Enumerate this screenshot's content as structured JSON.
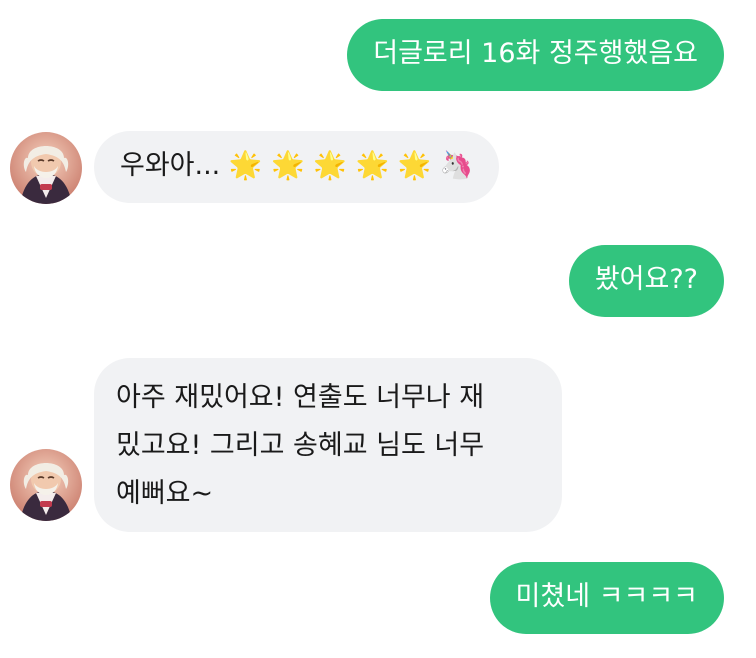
{
  "messages": [
    {
      "id": "m1",
      "from": "me",
      "text": "더글로리 16화 정주행했음요"
    },
    {
      "id": "m2",
      "from": "other",
      "text": "우와아... 🌟 🌟 🌟 🌟 🌟  🦄"
    },
    {
      "id": "m3",
      "from": "me",
      "text": "봤어요??"
    },
    {
      "id": "m4",
      "from": "other",
      "lines": [
        "아주 재밌어요! 연출도 너무나 재",
        "밌고요! 그리고 송혜교 님도 너무",
        "예뻐요~"
      ]
    },
    {
      "id": "m5",
      "from": "me",
      "text": "미쳤네 ㅋㅋㅋㅋ"
    }
  ],
  "colors": {
    "sent_bubble": "#32c47e",
    "received_bubble": "#f1f2f4",
    "sent_text": "#ffffff",
    "received_text": "#1a1a1a"
  },
  "icons": {
    "avatar": "elderly-sage-avatar-icon"
  }
}
